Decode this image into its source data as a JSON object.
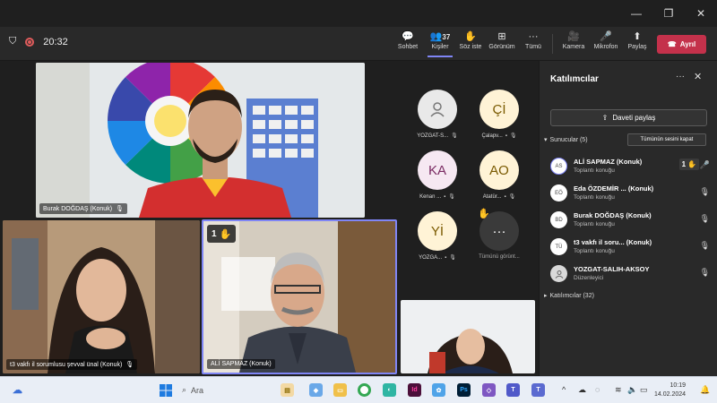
{
  "window": {
    "controls": [
      "—",
      "❐",
      "✕"
    ]
  },
  "toolbar": {
    "timer": "20:32",
    "people_count": "37",
    "buttons": [
      {
        "name": "chat",
        "label": "Sohbet",
        "icon": "💬"
      },
      {
        "name": "people",
        "label": "Kişiler",
        "icon": "👥"
      },
      {
        "name": "raise-hand",
        "label": "Söz iste",
        "icon": "✋"
      },
      {
        "name": "view",
        "label": "Görünüm",
        "icon": "⊞"
      },
      {
        "name": "more",
        "label": "Tümü",
        "icon": "···"
      },
      {
        "name": "camera",
        "label": "Kamera",
        "icon": "🎥"
      },
      {
        "name": "mic",
        "label": "Mikrofon",
        "icon": "🎤"
      },
      {
        "name": "share",
        "label": "Paylaş",
        "icon": "⬆"
      }
    ],
    "leave_label": "Ayrıl"
  },
  "stage": {
    "tiles": [
      {
        "name": "Burak DOĞDAŞ (Konuk)"
      },
      {
        "name": "t3 vakfı il sorumlusu şevval ünal (Konuk)"
      },
      {
        "name": "ALİ SAPMAZ (Konuk)",
        "hand_count": "1"
      }
    ],
    "mini": [
      {
        "initials": "",
        "label": "YOZGAT-S...",
        "bg": "#e9e9e9",
        "fg": "#555"
      },
      {
        "initials": "Çİ",
        "label": "Çalapv...",
        "bg": "#fff3d6",
        "fg": "#7a5a00"
      },
      {
        "initials": "KA",
        "label": "Kenan ...",
        "bg": "#f6e8f2",
        "fg": "#7a2a62"
      },
      {
        "initials": "AO",
        "label": "Atatür...",
        "bg": "#fff3d6",
        "fg": "#7a5a00"
      },
      {
        "initials": "Yİ",
        "label": "YOZGA...",
        "bg": "#fff3d6",
        "fg": "#7a5a00"
      },
      {
        "initials": "···",
        "label": "Tümünü görünt...",
        "bg": "#3a3a3a",
        "fg": "#fff"
      }
    ]
  },
  "panel": {
    "title": "Katılımcılar",
    "invite_label": "Daveti paylaş",
    "presenters_label": "Sunucular (5)",
    "mute_all_label": "Tümünün sesini kapat",
    "presenters": [
      {
        "initials": "AS",
        "name": "ALİ SAPMAZ (Konuk)",
        "role": "Toplantı konuğu",
        "hand": "1",
        "mic": "on"
      },
      {
        "initials": "EÖ",
        "name": "Eda ÖZDEMİR ...  (Konuk)",
        "role": "Toplantı konuğu",
        "mic": "off"
      },
      {
        "initials": "BD",
        "name": "Burak DOĞDAŞ (Konuk)",
        "role": "Toplantı konuğu",
        "mic": "off"
      },
      {
        "initials": "TÜ",
        "name": "t3 vakfı il soru...   (Konuk)",
        "role": "Toplantı konuğu",
        "mic": "off"
      },
      {
        "initials": "",
        "name": "YOZGAT-SALIH-AKSOY",
        "role": "Düzenleyici",
        "mic": "off"
      }
    ],
    "attendees_label": "Katılımcılar (32)"
  },
  "taskbar": {
    "search": "Ara",
    "time": "10:19",
    "date": "14.02.2024"
  }
}
